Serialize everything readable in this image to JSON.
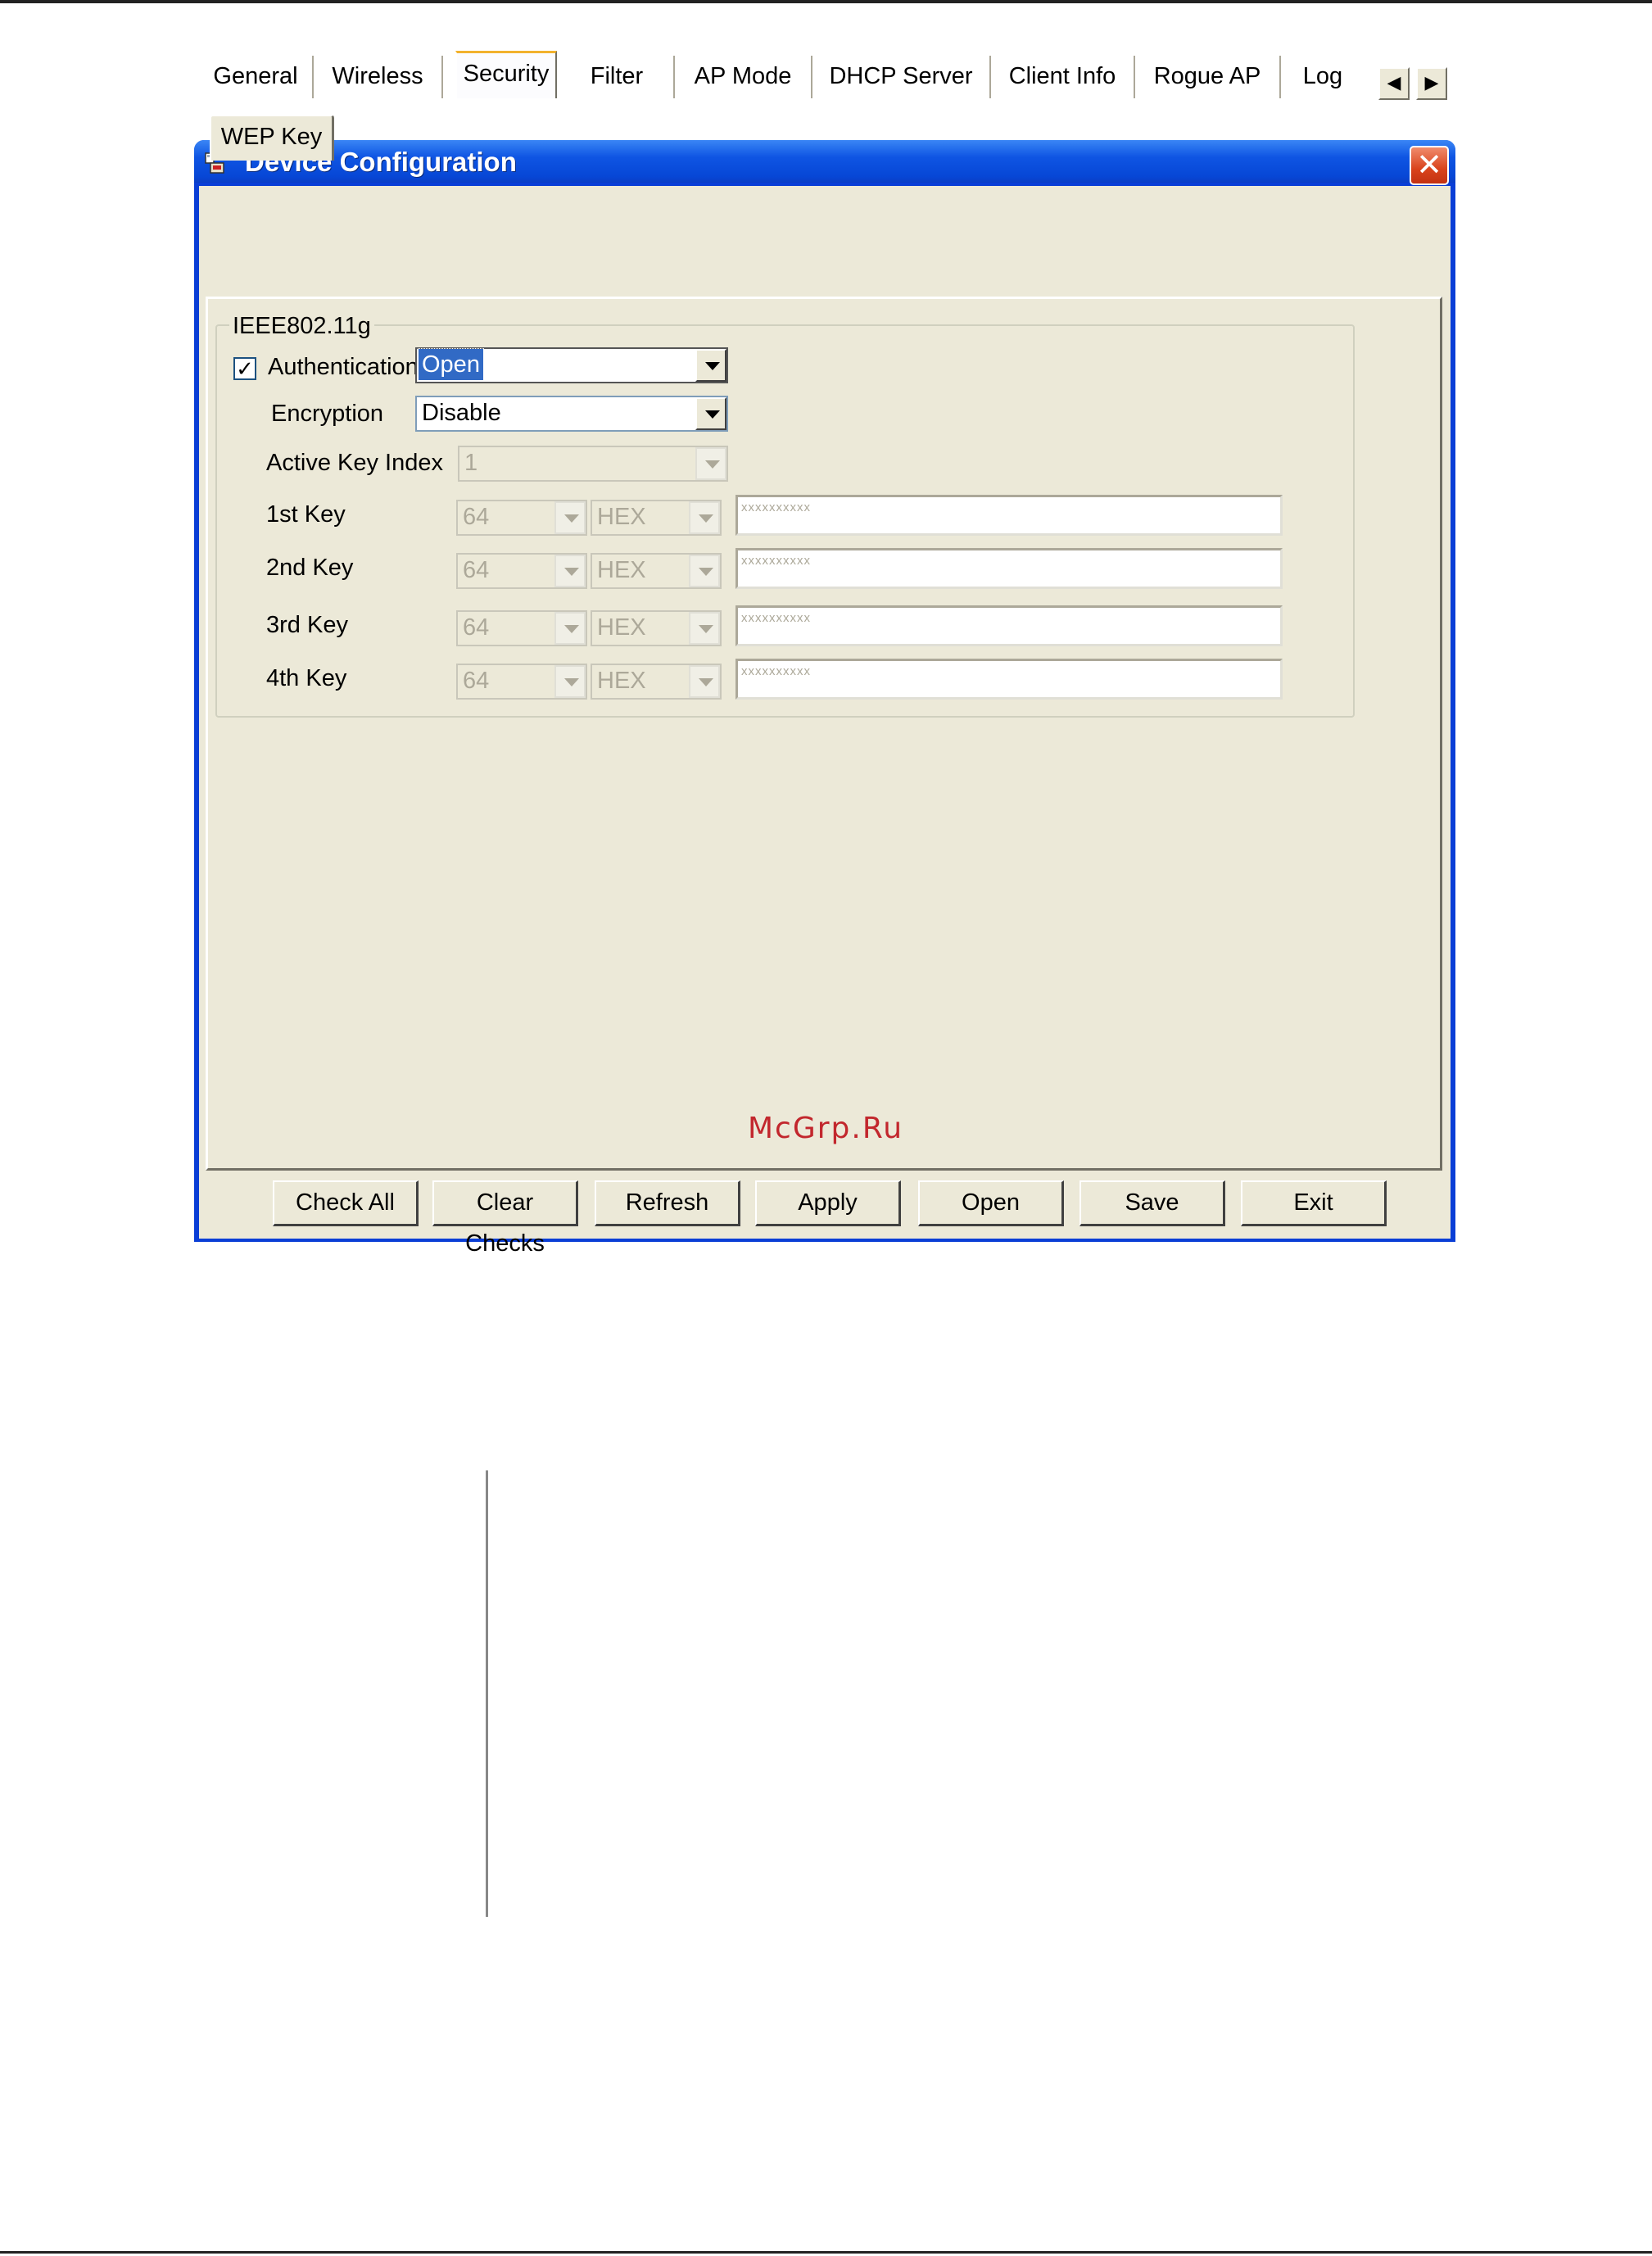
{
  "window": {
    "title": "Device Configuration"
  },
  "tabs": [
    {
      "label": "General"
    },
    {
      "label": "Wireless"
    },
    {
      "label": "Security"
    },
    {
      "label": "Filter"
    },
    {
      "label": "AP Mode"
    },
    {
      "label": "DHCP Server"
    },
    {
      "label": "Client Info"
    },
    {
      "label": "Rogue AP"
    },
    {
      "label": "Log"
    }
  ],
  "active_tab": "Security",
  "subtab": {
    "label": "WEP Key"
  },
  "group": {
    "label": "IEEE802.11g"
  },
  "form": {
    "authentication": {
      "label": "Authentication",
      "checked": true,
      "value": "Open"
    },
    "encryption": {
      "label": "Encryption",
      "value": "Disable"
    },
    "active_key_index": {
      "label": "Active Key Index",
      "value": "1"
    },
    "keys": [
      {
        "label": "1st Key",
        "length": "64",
        "format": "HEX",
        "value": "xxxxxxxxxx"
      },
      {
        "label": "2nd Key",
        "length": "64",
        "format": "HEX",
        "value": "xxxxxxxxxx"
      },
      {
        "label": "3rd Key",
        "length": "64",
        "format": "HEX",
        "value": "xxxxxxxxxx"
      },
      {
        "label": "4th Key",
        "length": "64",
        "format": "HEX",
        "value": "xxxxxxxxxx"
      }
    ]
  },
  "watermark": "McGrp.Ru",
  "buttons": [
    {
      "label": "Check All"
    },
    {
      "label": "Clear Checks"
    },
    {
      "label": "Refresh"
    },
    {
      "label": "Apply"
    },
    {
      "label": "Open"
    },
    {
      "label": "Save"
    },
    {
      "label": "Exit"
    }
  ],
  "colors": {
    "titlebar": "#0a3ed6",
    "close": "#d9431c",
    "panel": "#ece9d8",
    "selection": "#316ac5",
    "watermark": "#c2272d"
  }
}
